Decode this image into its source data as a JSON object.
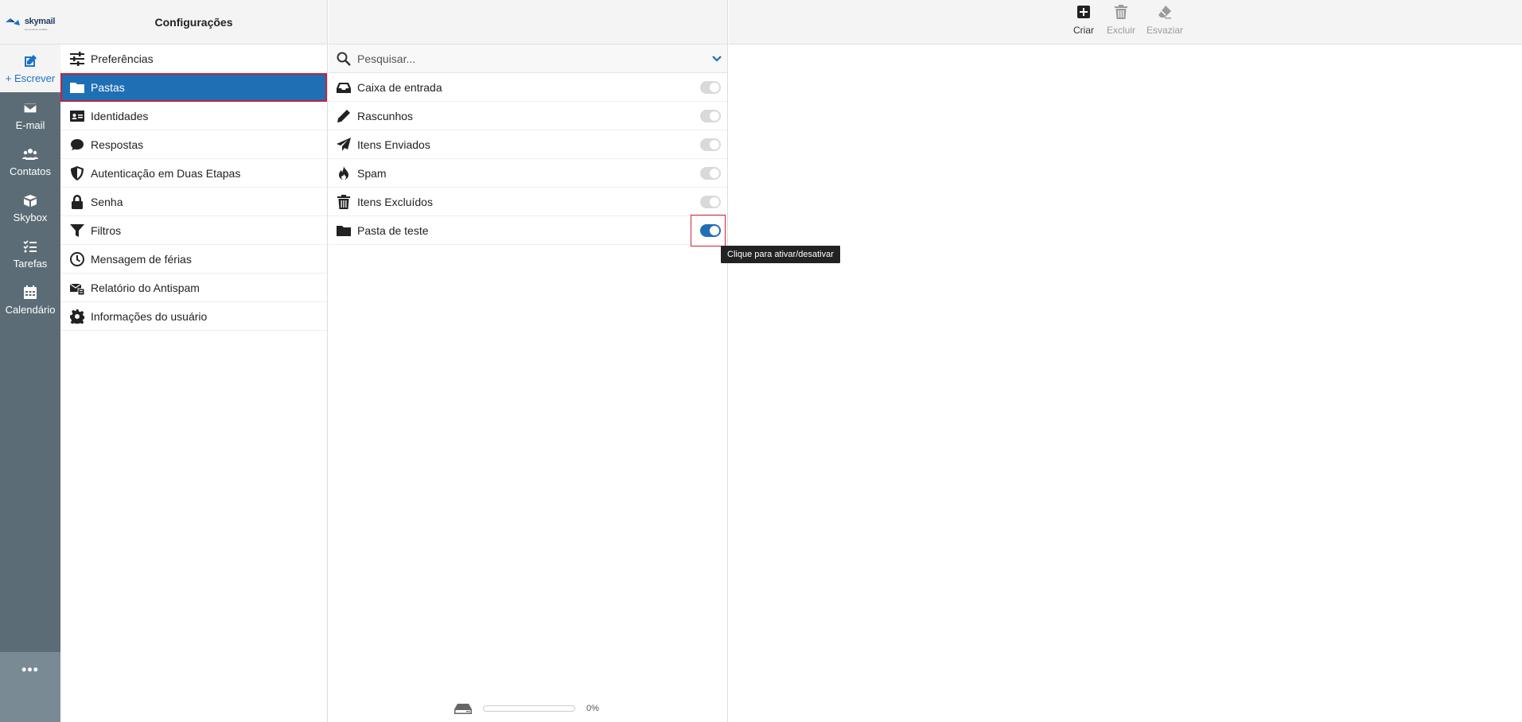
{
  "app": {
    "logo_text": "skymail",
    "logo_tagline": "seu email de verdade"
  },
  "rail": {
    "compose_label": "+ Escrever",
    "items": [
      {
        "label": "E-mail",
        "icon": "envelope-icon"
      },
      {
        "label": "Contatos",
        "icon": "users-icon"
      },
      {
        "label": "Skybox",
        "icon": "box-icon"
      },
      {
        "label": "Tarefas",
        "icon": "tasks-icon"
      },
      {
        "label": "Calendário",
        "icon": "calendar-icon"
      }
    ],
    "more_label": "•••"
  },
  "settings": {
    "title": "Configurações",
    "items": [
      {
        "label": "Preferências",
        "icon": "sliders-icon"
      },
      {
        "label": "Pastas",
        "icon": "folder-icon",
        "active": true
      },
      {
        "label": "Identidades",
        "icon": "id-card-icon"
      },
      {
        "label": "Respostas",
        "icon": "comment-icon"
      },
      {
        "label": "Autenticação em Duas Etapas",
        "icon": "shield-icon"
      },
      {
        "label": "Senha",
        "icon": "lock-icon"
      },
      {
        "label": "Filtros",
        "icon": "filter-icon"
      },
      {
        "label": "Mensagem de férias",
        "icon": "clock-icon"
      },
      {
        "label": "Relatório do Antispam",
        "icon": "mail-report-icon"
      },
      {
        "label": "Informações do usuário",
        "icon": "gear-icon"
      }
    ]
  },
  "folders": {
    "search_placeholder": "Pesquisar...",
    "items": [
      {
        "label": "Caixa de entrada",
        "icon": "inbox-icon",
        "subscribed": true,
        "enabled": false
      },
      {
        "label": "Rascunhos",
        "icon": "pencil-icon",
        "subscribed": true,
        "enabled": false
      },
      {
        "label": "Itens Enviados",
        "icon": "paper-plane-icon",
        "subscribed": true,
        "enabled": false
      },
      {
        "label": "Spam",
        "icon": "fire-icon",
        "subscribed": true,
        "enabled": false
      },
      {
        "label": "Itens Excluídos",
        "icon": "trash-icon",
        "subscribed": true,
        "enabled": false
      },
      {
        "label": "Pasta de teste",
        "icon": "folder-icon",
        "subscribed": true,
        "enabled": true
      }
    ],
    "tooltip": "Clique para ativar/desativar",
    "quota_label": "0%",
    "quota_value": 0
  },
  "toolbar": {
    "create_label": "Criar",
    "delete_label": "Excluir",
    "empty_label": "Esvaziar"
  },
  "colors": {
    "accent": "#1f6fb5",
    "rail": "#5c6c76",
    "highlight": "#d6202d"
  }
}
